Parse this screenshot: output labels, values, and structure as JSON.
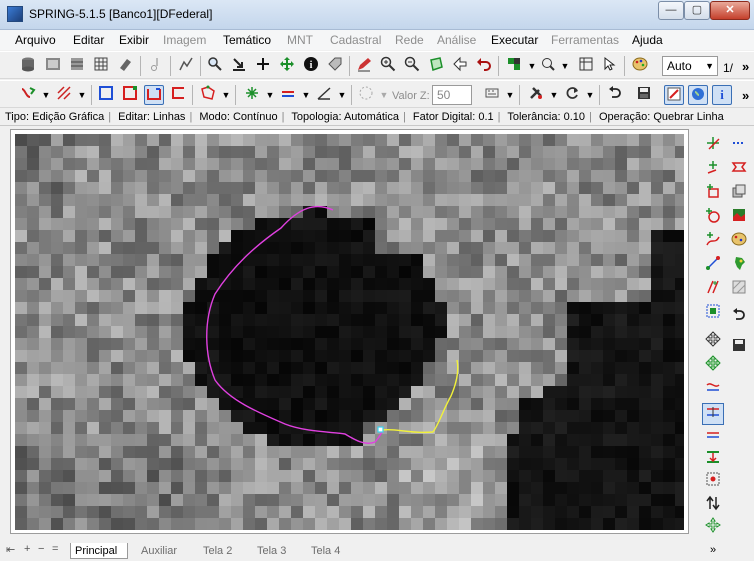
{
  "window": {
    "title": "SPRING-5.1.5 [Banco1][DFederal]",
    "minimize": "—",
    "maximize": "▢",
    "close": "✕"
  },
  "menu": {
    "items": [
      {
        "label": "Arquivo",
        "enabled": true
      },
      {
        "label": "Editar",
        "enabled": true
      },
      {
        "label": "Exibir",
        "enabled": true
      },
      {
        "label": "Imagem",
        "enabled": false
      },
      {
        "label": "Temático",
        "enabled": true
      },
      {
        "label": "MNT",
        "enabled": false
      },
      {
        "label": "Cadastral",
        "enabled": false
      },
      {
        "label": "Rede",
        "enabled": false
      },
      {
        "label": "Análise",
        "enabled": false
      },
      {
        "label": "Executar",
        "enabled": true
      },
      {
        "label": "Ferramentas",
        "enabled": false
      },
      {
        "label": "Ajuda",
        "enabled": true
      }
    ]
  },
  "toolbar1": {
    "zoom_mode": "Auto",
    "page_indicator": "1/",
    "overflow": "»"
  },
  "toolbar2": {
    "valor_z_label": "Valor Z:",
    "valor_z_value": "50",
    "overflow": "»"
  },
  "status": {
    "tipo": "Tipo: Edição Gráfica",
    "editar": "Editar: Linhas",
    "modo": "Modo: Contínuo",
    "topologia": "Topologia: Automática",
    "fator": "Fator Digital: 0.1",
    "tolerancia": "Tolerância: 0.10",
    "operacao": "Operação: Quebrar Linha"
  },
  "tabs": {
    "items": [
      "Principal",
      "Auxiliar",
      "Tela 2",
      "Tela 3",
      "Tela 4"
    ],
    "active": "Principal"
  },
  "colors": {
    "magenta_line": "#e040e0",
    "yellow_line": "#f2f23a",
    "selection_blue": "#3a6fb5"
  }
}
